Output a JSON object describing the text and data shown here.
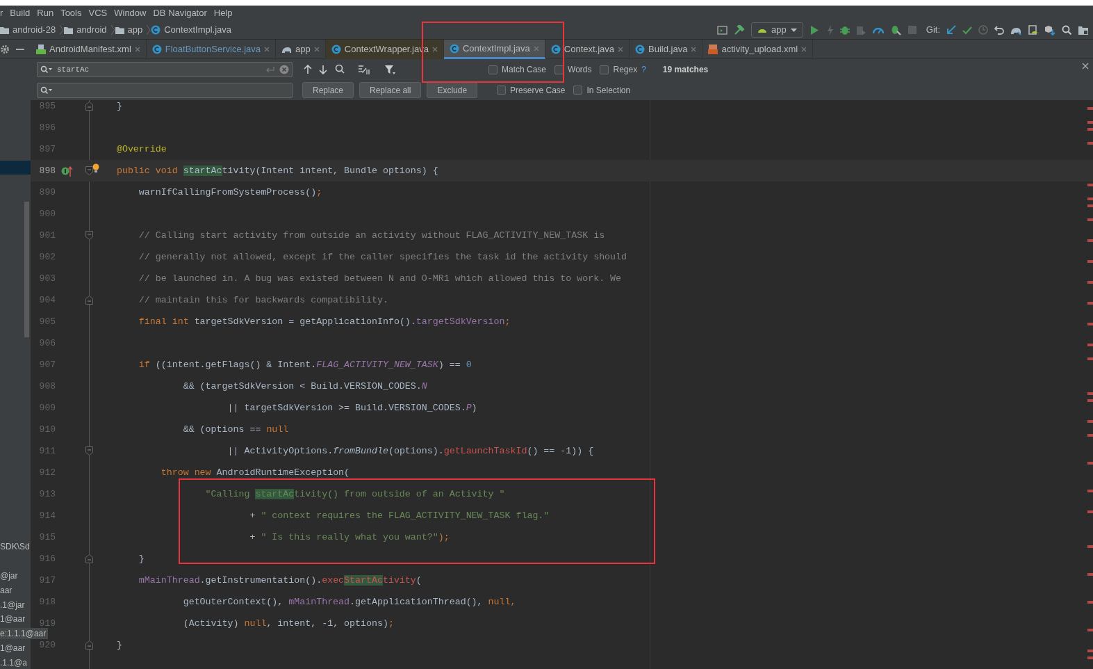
{
  "menu": [
    "r",
    "Build",
    "Run",
    "Tools",
    "VCS",
    "Window",
    "DB Navigator",
    "Help"
  ],
  "breadcrumbs": [
    {
      "label": "android-28",
      "kind": "folder"
    },
    {
      "label": "android",
      "kind": "folder"
    },
    {
      "label": "app",
      "kind": "folder"
    },
    {
      "label": "ContextImpl.java",
      "kind": "class"
    }
  ],
  "run_config": "app",
  "git_label": "Git:",
  "tabs": [
    {
      "label": "AndroidManifest.xml",
      "kind": "manifest",
      "selected": false
    },
    {
      "label": "FloatButtonService.java",
      "kind": "class",
      "selected": false
    },
    {
      "label": "app",
      "kind": "gradle",
      "selected": false
    },
    {
      "label": "ContextWrapper.java",
      "kind": "class",
      "selected": false
    },
    {
      "label": "ContextImpl.java",
      "kind": "class",
      "selected": true
    },
    {
      "label": "Context.java",
      "kind": "class",
      "selected": false
    },
    {
      "label": "Build.java",
      "kind": "class",
      "selected": false
    },
    {
      "label": "activity_upload.xml",
      "kind": "layout",
      "selected": false
    }
  ],
  "find": {
    "value": "startAc",
    "options": [
      {
        "label": "Match Case",
        "checked": false
      },
      {
        "label": "Words",
        "checked": false
      },
      {
        "label": "Regex",
        "checked": false
      }
    ],
    "help": "?",
    "matches": "19 matches"
  },
  "replace": {
    "buttons": [
      "Replace",
      "Replace all",
      "Exclude"
    ],
    "options": [
      {
        "label": "Preserve Case",
        "checked": false
      },
      {
        "label": "In Selection",
        "checked": false
      }
    ]
  },
  "project_tree": [
    {
      "label": "SDK\\Sd",
      "selected": false
    },
    {
      "label": "@jar",
      "selected": false
    },
    {
      "label": "aar",
      "selected": false
    },
    {
      "label": ".1@jar",
      "selected": false
    },
    {
      "label": "1@aar",
      "selected": false
    },
    {
      "label": "e:1.1.1@aar",
      "selected": true
    },
    {
      "label": "1@aar",
      "selected": false
    },
    {
      "label": ".1.1@a",
      "selected": false
    }
  ],
  "lines": [
    {
      "number": "895",
      "kind": "closer",
      "current": false,
      "code": [
        {
          "text": "    }",
          "kind": "plain"
        }
      ]
    },
    {
      "number": "896",
      "kind": "plain",
      "current": false
    },
    {
      "number": "897",
      "kind": "plain",
      "current": false,
      "code": [
        {
          "text": "    @Override",
          "kind": "annotation"
        }
      ]
    },
    {
      "number": "898",
      "kind": "opener",
      "current": true,
      "code": [
        {
          "text": "    public void ",
          "kind": "keyword"
        },
        {
          "text": "startAc",
          "kind": "match"
        },
        {
          "text": "tivity(Intent intent, Bundle options) {",
          "kind": "plain"
        }
      ]
    },
    {
      "number": "899",
      "kind": "plain",
      "current": false,
      "code": [
        {
          "text": "        warnIfCallingFromSystemProcess()",
          "kind": "plain"
        },
        {
          "text": ";",
          "kind": "keyword"
        }
      ]
    },
    {
      "number": "900",
      "kind": "plain",
      "current": false
    },
    {
      "number": "901",
      "kind": "opener",
      "current": false,
      "code": [
        {
          "text": "        // Calling start activity from outside an activity without FLAG_ACTIVITY_NEW_TASK is",
          "kind": "comment"
        }
      ]
    },
    {
      "number": "902",
      "kind": "plain",
      "current": false,
      "code": [
        {
          "text": "        // generally not allowed, except if the caller specifies the task id the activity should",
          "kind": "comment"
        }
      ]
    },
    {
      "number": "903",
      "kind": "plain",
      "current": false,
      "code": [
        {
          "text": "        // be launched in. A bug was existed between N and O-MR1 which allowed this to work. We",
          "kind": "comment"
        }
      ]
    },
    {
      "number": "904",
      "kind": "closer",
      "current": false,
      "code": [
        {
          "text": "        // maintain this for backwards compatibility.",
          "kind": "comment"
        }
      ]
    },
    {
      "number": "905",
      "kind": "plain",
      "current": false,
      "code": [
        {
          "text": "        final int ",
          "kind": "keyword"
        },
        {
          "text": "targetSdkVersion = getApplicationInfo().",
          "kind": "plain"
        },
        {
          "text": "targetSdkVersion",
          "kind": "field"
        },
        {
          "text": ";",
          "kind": "keyword"
        }
      ]
    },
    {
      "number": "906",
      "kind": "plain",
      "current": false
    },
    {
      "number": "907",
      "kind": "plain",
      "current": false,
      "code": [
        {
          "text": "        if ",
          "kind": "keyword"
        },
        {
          "text": "((intent.getFlags() & Intent.",
          "kind": "plain"
        },
        {
          "text": "FLAG_ACTIVITY_NEW_TASK",
          "kind": "static"
        },
        {
          "text": ") == ",
          "kind": "plain"
        },
        {
          "text": "0",
          "kind": "number"
        }
      ]
    },
    {
      "number": "908",
      "kind": "plain",
      "current": false,
      "code": [
        {
          "text": "                && (targetSdkVersion < Build.VERSION_CODES.",
          "kind": "plain"
        },
        {
          "text": "N",
          "kind": "static"
        }
      ]
    },
    {
      "number": "909",
      "kind": "plain",
      "current": false,
      "code": [
        {
          "text": "                        || targetSdkVersion >= Build.VERSION_CODES.",
          "kind": "plain"
        },
        {
          "text": "P",
          "kind": "static"
        },
        {
          "text": ")",
          "kind": "plain"
        }
      ]
    },
    {
      "number": "910",
      "kind": "plain",
      "current": false,
      "code": [
        {
          "text": "                && (options == ",
          "kind": "plain"
        },
        {
          "text": "null",
          "kind": "keyword"
        }
      ]
    },
    {
      "number": "911",
      "kind": "opener",
      "current": false,
      "code": [
        {
          "text": "                        || ActivityOptions.",
          "kind": "plain"
        },
        {
          "text": "fromBundle",
          "kind": "method"
        },
        {
          "text": "(options).",
          "kind": "plain"
        },
        {
          "text": "getLaunchTaskId",
          "kind": "error"
        },
        {
          "text": "() == -1)) {",
          "kind": "plain"
        }
      ]
    },
    {
      "number": "912",
      "kind": "plain",
      "current": false,
      "code": [
        {
          "text": "            throw new ",
          "kind": "keyword"
        },
        {
          "text": "AndroidRuntimeException(",
          "kind": "plain"
        }
      ]
    },
    {
      "number": "913",
      "kind": "plain",
      "current": false,
      "code": [
        {
          "text": "                    \"Calling ",
          "kind": "string"
        },
        {
          "text": "startAc",
          "kind": "stringmatch"
        },
        {
          "text": "tivity() from outside of an Activity \"",
          "kind": "string"
        }
      ]
    },
    {
      "number": "914",
      "kind": "plain",
      "current": false,
      "code": [
        {
          "text": "                            + ",
          "kind": "plain"
        },
        {
          "text": "\" context requires the FLAG_ACTIVITY_NEW_TASK flag.\"",
          "kind": "string"
        }
      ]
    },
    {
      "number": "915",
      "kind": "plain",
      "current": false,
      "code": [
        {
          "text": "                            + ",
          "kind": "plain"
        },
        {
          "text": "\" Is this really what you want?\"",
          "kind": "string"
        },
        {
          "text": ");",
          "kind": "keyword"
        }
      ]
    },
    {
      "number": "916",
      "kind": "closer",
      "current": false,
      "code": [
        {
          "text": "        }",
          "kind": "plain"
        }
      ]
    },
    {
      "number": "917",
      "kind": "plain",
      "current": false,
      "code": [
        {
          "text": "        mMainThread",
          "kind": "field"
        },
        {
          "text": ".getInstrumentation().",
          "kind": "plain"
        },
        {
          "text": "exec",
          "kind": "error"
        },
        {
          "text": "StartAc",
          "kind": "errormatch"
        },
        {
          "text": "tivity",
          "kind": "error"
        },
        {
          "text": "(",
          "kind": "plain"
        }
      ]
    },
    {
      "number": "918",
      "kind": "plain",
      "current": false,
      "code": [
        {
          "text": "                getOuterContext(), ",
          "kind": "plain"
        },
        {
          "text": "mMainThread",
          "kind": "field"
        },
        {
          "text": ".getApplicationThread(), ",
          "kind": "plain"
        },
        {
          "text": "null",
          "kind": "keyword"
        },
        {
          "text": ",",
          "kind": "keyword"
        }
      ]
    },
    {
      "number": "919",
      "kind": "plain",
      "current": false,
      "code": [
        {
          "text": "                (Activity) ",
          "kind": "plain"
        },
        {
          "text": "null",
          "kind": "keyword"
        },
        {
          "text": ", intent, -1, options)",
          "kind": "plain"
        },
        {
          "text": ";",
          "kind": "keyword"
        }
      ]
    },
    {
      "number": "920",
      "kind": "closer",
      "current": false,
      "code": [
        {
          "text": "    }",
          "kind": "plain"
        }
      ]
    }
  ]
}
